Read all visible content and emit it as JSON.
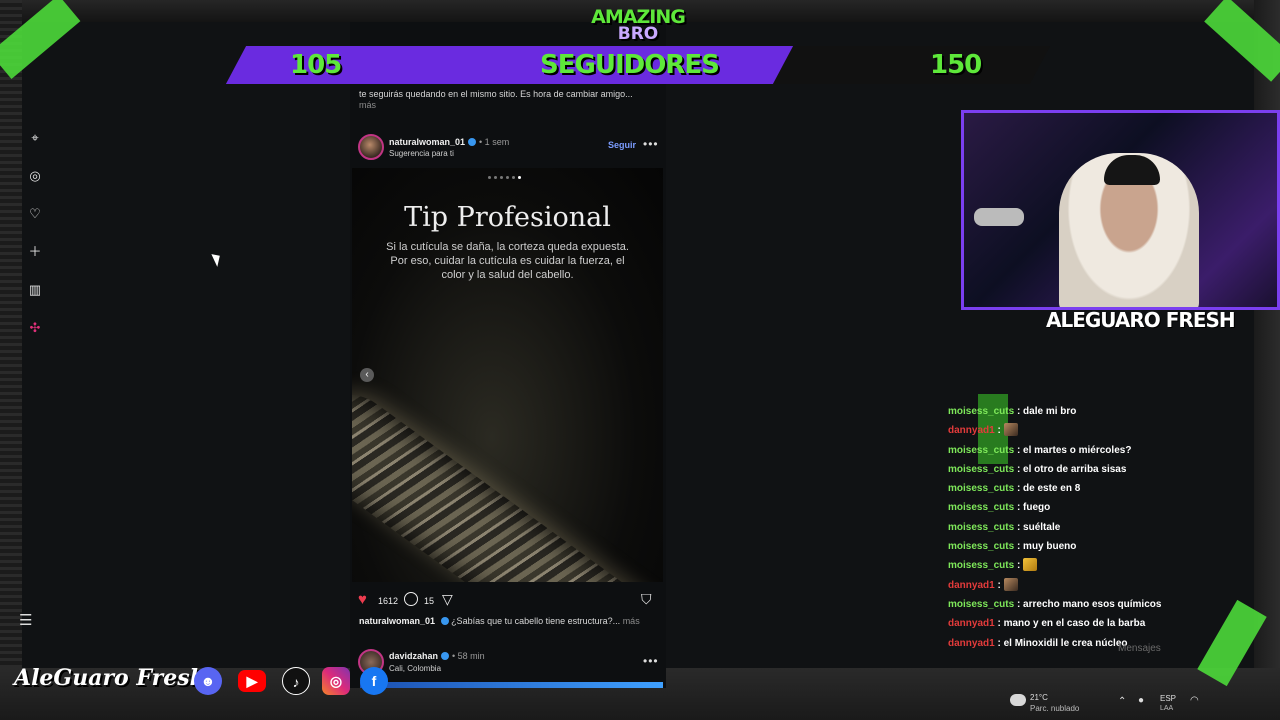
{
  "overlay": {
    "brand_top": "AMAZING",
    "brand_sub": "BRO",
    "goal_start": "105",
    "goal_label": "SEGUIDORES",
    "goal_end": "150",
    "goal_progress": 0.68,
    "streamer_name": "ALEGUARO FRESH",
    "social_brand": "AleGuaro Fresh",
    "socials": [
      "discord-icon",
      "youtube-icon",
      "tiktok-icon",
      "instagram-icon",
      "facebook-icon"
    ],
    "accent_green": "#5ee83a",
    "accent_purple": "#6a2be0"
  },
  "nav_rail": {
    "icons": [
      "bookmark-icon",
      "compass-icon",
      "heart-notification-icon",
      "create-icon",
      "dashboard-icon",
      "threads-icon"
    ],
    "menu_glyph": "☰"
  },
  "feed": {
    "prev_caption": "te seguirás quedando en el mismo sitio. Es hora de cambiar amigo...",
    "prev_more": "más",
    "post": {
      "username": "naturalwoman_01",
      "time": "• 1 sem",
      "subtitle": "Sugerencia para ti",
      "follow_label": "Seguir",
      "more_glyph": "•••",
      "image_title": "Tip Profesional",
      "image_body": "Si la cutícula se daña, la corteza queda expuesta. Por eso, cuidar la cutícula es cuidar la fuerza, el color y la salud del cabello.",
      "carousel_count": 6,
      "carousel_active": 5,
      "likes": "1612",
      "comments": "15",
      "caption_user": "naturalwoman_01",
      "caption_text": "¿Sabías que tu cabello tiene estructura?...",
      "caption_more": "más"
    },
    "next_post": {
      "username": "davidzahan",
      "time": "• 58 min",
      "location": "Cali, Colombia",
      "more_glyph": "•••"
    }
  },
  "chat": {
    "messages": [
      {
        "user": "moisess_cuts",
        "color": "green",
        "text": ": dale mi bro",
        "emote": ""
      },
      {
        "user": "dannyad1",
        "color": "red",
        "text": ":",
        "emote": "face"
      },
      {
        "user": "moisess_cuts",
        "color": "green",
        "text": ": el martes o miércoles?",
        "emote": ""
      },
      {
        "user": "moisess_cuts",
        "color": "green",
        "text": ": el otro de arriba sisas",
        "emote": ""
      },
      {
        "user": "moisess_cuts",
        "color": "green",
        "text": ": de este en 8",
        "emote": ""
      },
      {
        "user": "moisess_cuts",
        "color": "green",
        "text": ": fuego",
        "emote": ""
      },
      {
        "user": "moisess_cuts",
        "color": "green",
        "text": ": suéltale",
        "emote": ""
      },
      {
        "user": "moisess_cuts",
        "color": "green",
        "text": ": muy bueno",
        "emote": ""
      },
      {
        "user": "moisess_cuts",
        "color": "green",
        "text": ":",
        "emote": "gold"
      },
      {
        "user": "dannyad1",
        "color": "red",
        "text": ":",
        "emote": "face"
      },
      {
        "user": "moisess_cuts",
        "color": "green",
        "text": ": arrecho mano esos químicos",
        "emote": ""
      },
      {
        "user": "dannyad1",
        "color": "red",
        "text": ": mano y en el caso de la barba",
        "emote": ""
      },
      {
        "user": "dannyad1",
        "color": "red",
        "text": ": el Minoxidil le crea núcleo",
        "emote": ""
      }
    ],
    "input_hint": "Mensajes"
  },
  "taskbar": {
    "temp": "21°C",
    "condition": "Parc. nublado",
    "lang": "ESP",
    "lang_sub": "LAA"
  }
}
